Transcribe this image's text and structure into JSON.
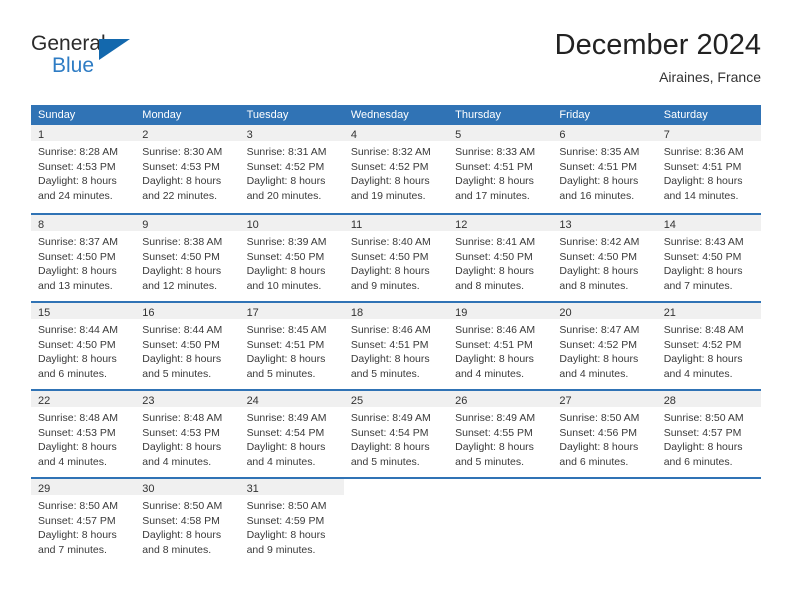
{
  "brand": {
    "name_primary": "General",
    "name_secondary": "Blue",
    "triangle_color": "#1368ad"
  },
  "header": {
    "month_title": "December 2024",
    "location": "Airaines, France"
  },
  "colors": {
    "header_blue": "#3073b5",
    "day_band_gray": "#f0f0f0",
    "text": "#333333"
  },
  "weekdays": [
    "Sunday",
    "Monday",
    "Tuesday",
    "Wednesday",
    "Thursday",
    "Friday",
    "Saturday"
  ],
  "weeks": [
    [
      {
        "day": "1",
        "sunrise": "Sunrise: 8:28 AM",
        "sunset": "Sunset: 4:53 PM",
        "daylight_line1": "Daylight: 8 hours",
        "daylight_line2": "and 24 minutes."
      },
      {
        "day": "2",
        "sunrise": "Sunrise: 8:30 AM",
        "sunset": "Sunset: 4:53 PM",
        "daylight_line1": "Daylight: 8 hours",
        "daylight_line2": "and 22 minutes."
      },
      {
        "day": "3",
        "sunrise": "Sunrise: 8:31 AM",
        "sunset": "Sunset: 4:52 PM",
        "daylight_line1": "Daylight: 8 hours",
        "daylight_line2": "and 20 minutes."
      },
      {
        "day": "4",
        "sunrise": "Sunrise: 8:32 AM",
        "sunset": "Sunset: 4:52 PM",
        "daylight_line1": "Daylight: 8 hours",
        "daylight_line2": "and 19 minutes."
      },
      {
        "day": "5",
        "sunrise": "Sunrise: 8:33 AM",
        "sunset": "Sunset: 4:51 PM",
        "daylight_line1": "Daylight: 8 hours",
        "daylight_line2": "and 17 minutes."
      },
      {
        "day": "6",
        "sunrise": "Sunrise: 8:35 AM",
        "sunset": "Sunset: 4:51 PM",
        "daylight_line1": "Daylight: 8 hours",
        "daylight_line2": "and 16 minutes."
      },
      {
        "day": "7",
        "sunrise": "Sunrise: 8:36 AM",
        "sunset": "Sunset: 4:51 PM",
        "daylight_line1": "Daylight: 8 hours",
        "daylight_line2": "and 14 minutes."
      }
    ],
    [
      {
        "day": "8",
        "sunrise": "Sunrise: 8:37 AM",
        "sunset": "Sunset: 4:50 PM",
        "daylight_line1": "Daylight: 8 hours",
        "daylight_line2": "and 13 minutes."
      },
      {
        "day": "9",
        "sunrise": "Sunrise: 8:38 AM",
        "sunset": "Sunset: 4:50 PM",
        "daylight_line1": "Daylight: 8 hours",
        "daylight_line2": "and 12 minutes."
      },
      {
        "day": "10",
        "sunrise": "Sunrise: 8:39 AM",
        "sunset": "Sunset: 4:50 PM",
        "daylight_line1": "Daylight: 8 hours",
        "daylight_line2": "and 10 minutes."
      },
      {
        "day": "11",
        "sunrise": "Sunrise: 8:40 AM",
        "sunset": "Sunset: 4:50 PM",
        "daylight_line1": "Daylight: 8 hours",
        "daylight_line2": "and 9 minutes."
      },
      {
        "day": "12",
        "sunrise": "Sunrise: 8:41 AM",
        "sunset": "Sunset: 4:50 PM",
        "daylight_line1": "Daylight: 8 hours",
        "daylight_line2": "and 8 minutes."
      },
      {
        "day": "13",
        "sunrise": "Sunrise: 8:42 AM",
        "sunset": "Sunset: 4:50 PM",
        "daylight_line1": "Daylight: 8 hours",
        "daylight_line2": "and 8 minutes."
      },
      {
        "day": "14",
        "sunrise": "Sunrise: 8:43 AM",
        "sunset": "Sunset: 4:50 PM",
        "daylight_line1": "Daylight: 8 hours",
        "daylight_line2": "and 7 minutes."
      }
    ],
    [
      {
        "day": "15",
        "sunrise": "Sunrise: 8:44 AM",
        "sunset": "Sunset: 4:50 PM",
        "daylight_line1": "Daylight: 8 hours",
        "daylight_line2": "and 6 minutes."
      },
      {
        "day": "16",
        "sunrise": "Sunrise: 8:44 AM",
        "sunset": "Sunset: 4:50 PM",
        "daylight_line1": "Daylight: 8 hours",
        "daylight_line2": "and 5 minutes."
      },
      {
        "day": "17",
        "sunrise": "Sunrise: 8:45 AM",
        "sunset": "Sunset: 4:51 PM",
        "daylight_line1": "Daylight: 8 hours",
        "daylight_line2": "and 5 minutes."
      },
      {
        "day": "18",
        "sunrise": "Sunrise: 8:46 AM",
        "sunset": "Sunset: 4:51 PM",
        "daylight_line1": "Daylight: 8 hours",
        "daylight_line2": "and 5 minutes."
      },
      {
        "day": "19",
        "sunrise": "Sunrise: 8:46 AM",
        "sunset": "Sunset: 4:51 PM",
        "daylight_line1": "Daylight: 8 hours",
        "daylight_line2": "and 4 minutes."
      },
      {
        "day": "20",
        "sunrise": "Sunrise: 8:47 AM",
        "sunset": "Sunset: 4:52 PM",
        "daylight_line1": "Daylight: 8 hours",
        "daylight_line2": "and 4 minutes."
      },
      {
        "day": "21",
        "sunrise": "Sunrise: 8:48 AM",
        "sunset": "Sunset: 4:52 PM",
        "daylight_line1": "Daylight: 8 hours",
        "daylight_line2": "and 4 minutes."
      }
    ],
    [
      {
        "day": "22",
        "sunrise": "Sunrise: 8:48 AM",
        "sunset": "Sunset: 4:53 PM",
        "daylight_line1": "Daylight: 8 hours",
        "daylight_line2": "and 4 minutes."
      },
      {
        "day": "23",
        "sunrise": "Sunrise: 8:48 AM",
        "sunset": "Sunset: 4:53 PM",
        "daylight_line1": "Daylight: 8 hours",
        "daylight_line2": "and 4 minutes."
      },
      {
        "day": "24",
        "sunrise": "Sunrise: 8:49 AM",
        "sunset": "Sunset: 4:54 PM",
        "daylight_line1": "Daylight: 8 hours",
        "daylight_line2": "and 4 minutes."
      },
      {
        "day": "25",
        "sunrise": "Sunrise: 8:49 AM",
        "sunset": "Sunset: 4:54 PM",
        "daylight_line1": "Daylight: 8 hours",
        "daylight_line2": "and 5 minutes."
      },
      {
        "day": "26",
        "sunrise": "Sunrise: 8:49 AM",
        "sunset": "Sunset: 4:55 PM",
        "daylight_line1": "Daylight: 8 hours",
        "daylight_line2": "and 5 minutes."
      },
      {
        "day": "27",
        "sunrise": "Sunrise: 8:50 AM",
        "sunset": "Sunset: 4:56 PM",
        "daylight_line1": "Daylight: 8 hours",
        "daylight_line2": "and 6 minutes."
      },
      {
        "day": "28",
        "sunrise": "Sunrise: 8:50 AM",
        "sunset": "Sunset: 4:57 PM",
        "daylight_line1": "Daylight: 8 hours",
        "daylight_line2": "and 6 minutes."
      }
    ],
    [
      {
        "day": "29",
        "sunrise": "Sunrise: 8:50 AM",
        "sunset": "Sunset: 4:57 PM",
        "daylight_line1": "Daylight: 8 hours",
        "daylight_line2": "and 7 minutes."
      },
      {
        "day": "30",
        "sunrise": "Sunrise: 8:50 AM",
        "sunset": "Sunset: 4:58 PM",
        "daylight_line1": "Daylight: 8 hours",
        "daylight_line2": "and 8 minutes."
      },
      {
        "day": "31",
        "sunrise": "Sunrise: 8:50 AM",
        "sunset": "Sunset: 4:59 PM",
        "daylight_line1": "Daylight: 8 hours",
        "daylight_line2": "and 9 minutes."
      },
      {
        "day": "",
        "sunrise": "",
        "sunset": "",
        "daylight_line1": "",
        "daylight_line2": ""
      },
      {
        "day": "",
        "sunrise": "",
        "sunset": "",
        "daylight_line1": "",
        "daylight_line2": ""
      },
      {
        "day": "",
        "sunrise": "",
        "sunset": "",
        "daylight_line1": "",
        "daylight_line2": ""
      },
      {
        "day": "",
        "sunrise": "",
        "sunset": "",
        "daylight_line1": "",
        "daylight_line2": ""
      }
    ]
  ]
}
